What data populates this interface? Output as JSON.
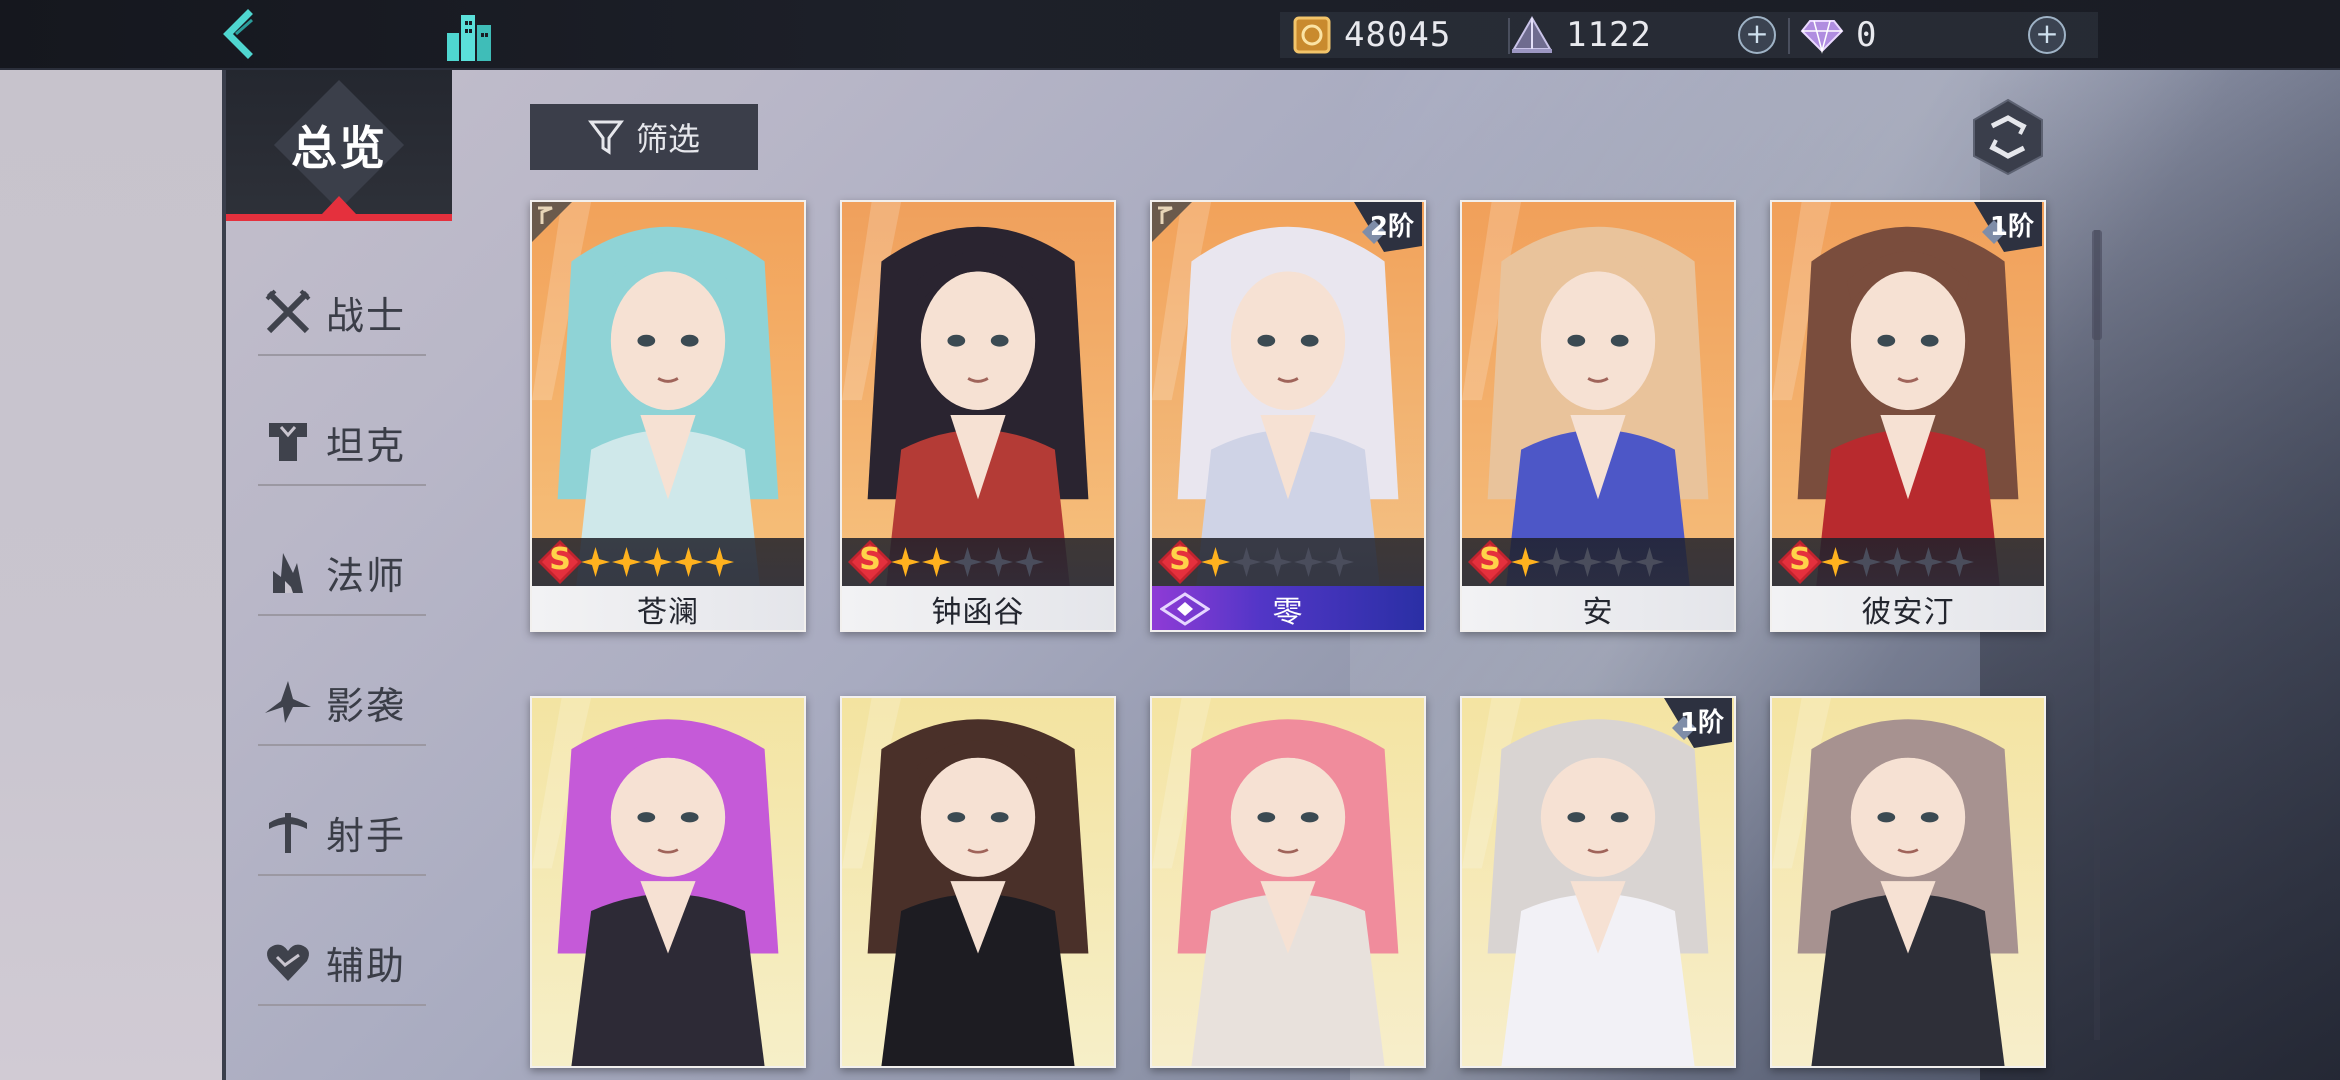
{
  "topbar": {
    "back_icon": "chevron-left-icon",
    "home_icon": "city-buildings-icon",
    "gold": {
      "icon": "gold-coin-icon",
      "value": "48045"
    },
    "crystal": {
      "icon": "crystal-pyramid-icon",
      "value": "1122"
    },
    "gem": {
      "icon": "diamond-gem-icon",
      "value": "0"
    },
    "plus_label": "+"
  },
  "sidebar": {
    "overview_label": "总览",
    "roles": [
      {
        "label": "战士",
        "icon": "crossed-swords-icon"
      },
      {
        "label": "坦克",
        "icon": "shield-armor-icon"
      },
      {
        "label": "法师",
        "icon": "mage-flame-icon"
      },
      {
        "label": "影袭",
        "icon": "shuriken-icon"
      },
      {
        "label": "射手",
        "icon": "crossbow-icon"
      },
      {
        "label": "辅助",
        "icon": "heart-icon"
      }
    ]
  },
  "toolbar": {
    "filter_label": "筛选",
    "filter_icon": "funnel-icon",
    "refresh_icon": "refresh-icon"
  },
  "colors": {
    "accent_red": "#e5303d",
    "star_gold": "#ffb21e",
    "rank_gold": "#ffd24a"
  },
  "characters": [
    {
      "name": "苍澜",
      "rank": "S",
      "stars": 5,
      "tier": ""
    },
    {
      "name": "钟函谷",
      "rank": "S",
      "stars": 2,
      "tier": ""
    },
    {
      "name": "零",
      "rank": "S",
      "stars": 1,
      "tier": "2阶"
    },
    {
      "name": "安",
      "rank": "S",
      "stars": 1,
      "tier": ""
    },
    {
      "name": "彼安汀",
      "rank": "S",
      "stars": 1,
      "tier": "1阶"
    },
    {
      "name": "",
      "rank": "",
      "stars": 0,
      "tier": ""
    },
    {
      "name": "",
      "rank": "",
      "stars": 0,
      "tier": ""
    },
    {
      "name": "",
      "rank": "",
      "stars": 0,
      "tier": ""
    },
    {
      "name": "",
      "rank": "",
      "stars": 0,
      "tier": "1阶"
    },
    {
      "name": "",
      "rank": "",
      "stars": 0,
      "tier": ""
    }
  ]
}
